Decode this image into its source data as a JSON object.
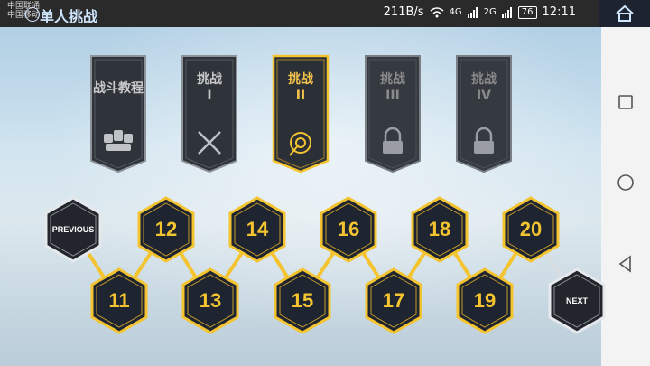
{
  "status_bar": {
    "carrier_line1": "中国联通",
    "carrier_line2": "中国移动",
    "app_title": "单人挑战",
    "net_speed": "211B/s",
    "signal_1": "4G",
    "signal_2": "2G",
    "battery": "76",
    "time": "12:11"
  },
  "tabs": [
    {
      "line1": "战斗教程",
      "line2": "",
      "icon": "soldiers-icon",
      "state": "normal"
    },
    {
      "line1": "挑战",
      "line2": "I",
      "icon": "crossed-swords-icon",
      "state": "normal"
    },
    {
      "line1": "挑战",
      "line2": "II",
      "icon": "target-icon",
      "state": "active"
    },
    {
      "line1": "挑战",
      "line2": "III",
      "icon": "lock-icon",
      "state": "locked"
    },
    {
      "line1": "挑战",
      "line2": "IV",
      "icon": "lock-icon",
      "state": "locked"
    }
  ],
  "levels_top": [
    "12",
    "14",
    "16",
    "18",
    "20"
  ],
  "levels_bottom": [
    "11",
    "13",
    "15",
    "17",
    "19"
  ],
  "previous_label": "PREVIOUS",
  "next_label": "NEXT",
  "colors": {
    "gold": "#f4c430",
    "banner_dark": "#2b2f36",
    "hex_fill": "#1e2530"
  }
}
